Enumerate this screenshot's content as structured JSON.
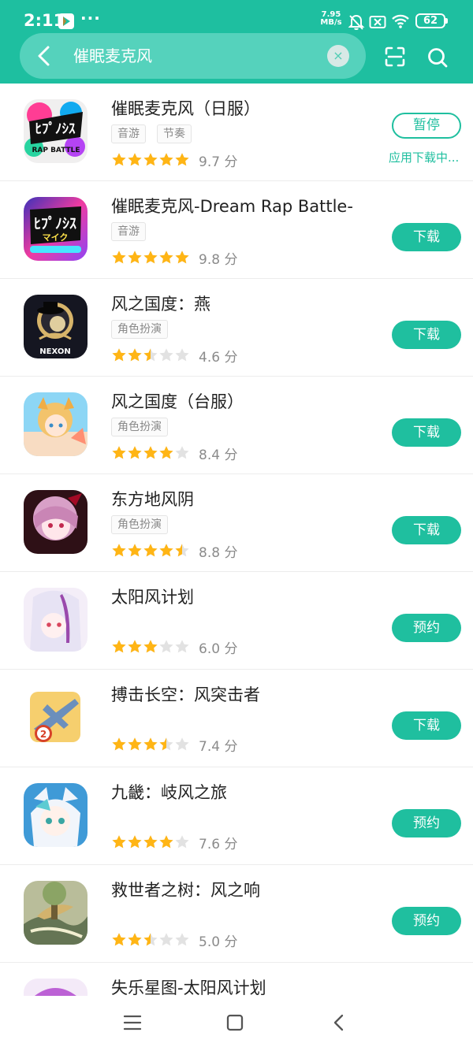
{
  "status_bar": {
    "time": "2:11",
    "more_indicator": "···",
    "network_speed_value": "7.95",
    "network_speed_unit": "MB/s",
    "battery_level": "62"
  },
  "search": {
    "query": "催眠麦克风",
    "clear_symbol": "×"
  },
  "icons": {
    "back": "back-arrow-icon",
    "clear": "clear-icon",
    "scan": "scan-icon",
    "search": "search-icon",
    "menu": "menu-icon",
    "home": "home-icon",
    "nav_back": "nav-back-icon"
  },
  "theme": {
    "accent": "#1ebfa0",
    "accent_light": "#55d2bc",
    "star_filled": "#ffb515",
    "star_empty": "#e2e2e2"
  },
  "results": [
    {
      "name": "催眠麦克风（日服）",
      "tags": [
        "音游",
        "节奏"
      ],
      "rating": 5,
      "rating_label": "9.7 分",
      "action": "暂停",
      "status": "应用下载中...",
      "icon": "hypnosis-mic-jp-icon"
    },
    {
      "name": "催眠麦克风-Dream Rap Battle-",
      "tags": [
        "音游"
      ],
      "rating": 5,
      "rating_label": "9.8 分",
      "action": "下载",
      "icon": "hypnosis-mic-drb-icon"
    },
    {
      "name": "风之国度：燕",
      "tags": [
        "角色扮演"
      ],
      "rating": 2.5,
      "rating_label": "4.6 分",
      "action": "下载",
      "icon": "nexon-hat-icon"
    },
    {
      "name": "风之国度（台服）",
      "tags": [
        "角色扮演"
      ],
      "rating": 4,
      "rating_label": "8.4 分",
      "action": "下载",
      "icon": "anime-fox-girl-icon"
    },
    {
      "name": "东方地风阴",
      "tags": [
        "角色扮演"
      ],
      "rating": 4.5,
      "rating_label": "8.8 分",
      "action": "下载",
      "icon": "touhou-girl-icon"
    },
    {
      "name": "太阳风计划",
      "tags": [],
      "rating": 3,
      "rating_label": "6.0 分",
      "action": "预约",
      "icon": "white-hair-girl-icon"
    },
    {
      "name": "搏击长空：风突击者",
      "tags": [],
      "rating": 3.5,
      "rating_label": "7.4 分",
      "action": "下载",
      "icon": "warplane-icon"
    },
    {
      "name": "九畿：岐风之旅",
      "tags": [],
      "rating": 4,
      "rating_label": "7.6 分",
      "action": "预约",
      "icon": "chibi-girl-icon"
    },
    {
      "name": "救世者之树：风之响",
      "tags": [],
      "rating": 2.5,
      "rating_label": "5.0 分",
      "action": "预约",
      "icon": "fantasy-landscape-icon"
    },
    {
      "name": "失乐星图-太阳风计划",
      "tags": [],
      "rating_label": "",
      "icon": "purple-hair-girl-icon"
    }
  ]
}
